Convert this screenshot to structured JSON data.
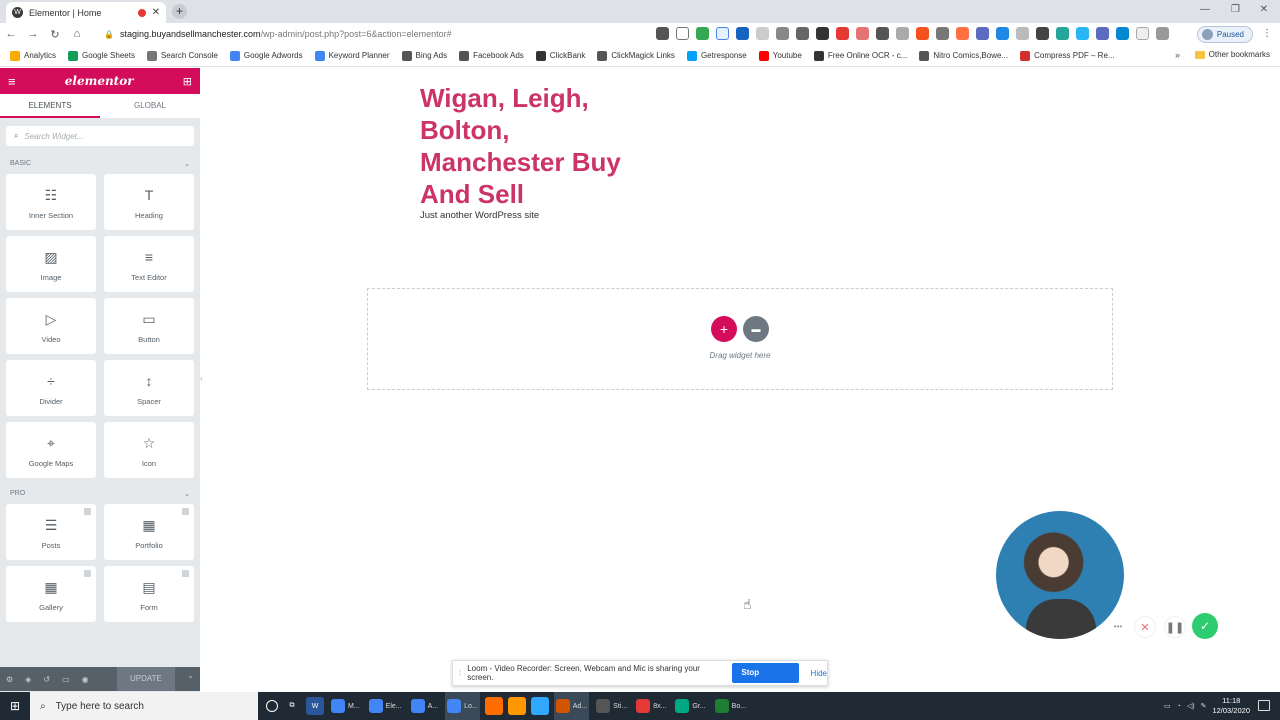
{
  "browser": {
    "tab_title": "Elementor | Home",
    "url_host": "staging.buyandsellmanchester.com",
    "url_path": "/wp-admin/post.php?post=6&action=elementor#",
    "profile_label": "Paused",
    "bookmarks": [
      {
        "label": "Analytics",
        "color": "#f9ab00"
      },
      {
        "label": "Google Sheets",
        "color": "#0f9d58"
      },
      {
        "label": "Search Console",
        "color": "#757575"
      },
      {
        "label": "Google Adwords",
        "color": "#4285f4"
      },
      {
        "label": "Keyword Planner",
        "color": "#4285f4"
      },
      {
        "label": "Bing Ads",
        "color": "#555555"
      },
      {
        "label": "Facebook Ads",
        "color": "#555555"
      },
      {
        "label": "ClickBank",
        "color": "#333333"
      },
      {
        "label": "ClickMagick Links",
        "color": "#555555"
      },
      {
        "label": "Getresponse",
        "color": "#00a2ff"
      },
      {
        "label": "Youtube",
        "color": "#ff0000"
      },
      {
        "label": "Free Online OCR - c...",
        "color": "#333333"
      },
      {
        "label": "Nitro Comics,Bowe...",
        "color": "#555555"
      },
      {
        "label": "Compress PDF – Re...",
        "color": "#d32f2f"
      }
    ],
    "other_bookmarks": "Other bookmarks"
  },
  "panel": {
    "tabs": [
      "ELEMENTS",
      "GLOBAL"
    ],
    "search_placeholder": "Search Widget...",
    "categories": {
      "basic": "BASIC",
      "pro": "PRO"
    },
    "basic_widgets": [
      {
        "label": "Inner Section",
        "icon": "inner-section-icon",
        "glyph": "☷"
      },
      {
        "label": "Heading",
        "icon": "heading-icon",
        "glyph": "T"
      },
      {
        "label": "Image",
        "icon": "image-icon",
        "glyph": "▨"
      },
      {
        "label": "Text Editor",
        "icon": "text-editor-icon",
        "glyph": "≡"
      },
      {
        "label": "Video",
        "icon": "video-icon",
        "glyph": "▷"
      },
      {
        "label": "Button",
        "icon": "button-icon",
        "glyph": "▭"
      },
      {
        "label": "Divider",
        "icon": "divider-icon",
        "glyph": "÷"
      },
      {
        "label": "Spacer",
        "icon": "spacer-icon",
        "glyph": "↕"
      },
      {
        "label": "Google Maps",
        "icon": "map-icon",
        "glyph": "⌖"
      },
      {
        "label": "Icon",
        "icon": "star-icon",
        "glyph": "☆"
      }
    ],
    "pro_widgets": [
      {
        "label": "Posts",
        "icon": "posts-icon",
        "glyph": "☰"
      },
      {
        "label": "Portfolio",
        "icon": "portfolio-icon",
        "glyph": "▦"
      },
      {
        "label": "Gallery",
        "icon": "gallery-icon",
        "glyph": "▦"
      },
      {
        "label": "Form",
        "icon": "form-icon",
        "glyph": "▤"
      }
    ],
    "update_label": "UPDATE"
  },
  "canvas": {
    "site_title": "Wigan, Leigh, Bolton, Manchester Buy And Sell",
    "tagline": "Just another WordPress site",
    "drop_hint": "Drag widget here"
  },
  "loom": {
    "share_message": "Loom - Video Recorder: Screen, Webcam and Mic is sharing your screen.",
    "stop_label": "Stop sharing",
    "hide_label": "Hide"
  },
  "taskbar": {
    "search_placeholder": "Type here to search",
    "apps": [
      {
        "label": "M...",
        "color": "#4285f4"
      },
      {
        "label": "Ele...",
        "color": "#4285f4"
      },
      {
        "label": "A...",
        "color": "#4285f4"
      },
      {
        "label": "Lo...",
        "color": "#4285f4"
      }
    ],
    "apps_right": [
      {
        "label": "Ad...",
        "color": "#d35400"
      },
      {
        "label": "Sti...",
        "color": "#555555"
      },
      {
        "label": "8x...",
        "color": "#e53935"
      },
      {
        "label": "Gr...",
        "color": "#00a884"
      },
      {
        "label": "Bo...",
        "color": "#1e7e34"
      }
    ],
    "time": "11:18",
    "date": "12/03/2020"
  },
  "colors": {
    "elementor_pink": "#d30c5c",
    "site_title_color": "#cc3366",
    "loom_blue": "#1a73e8",
    "loom_green": "#2ecc71"
  }
}
